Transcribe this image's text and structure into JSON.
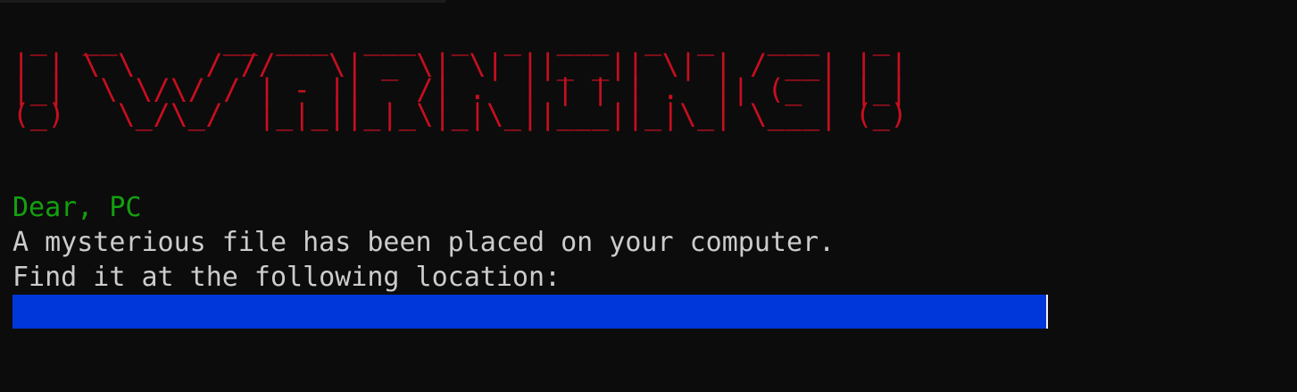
{
  "banner": {
    "lines": [
      " _  __      __ ___  ___  _  _  ___  _  _   ___   _ ",
      "| | \\ \\    / //   \\| _ \\| \\| ||_ _|| \\| | / __| | |",
      "|_|  \\ \\/\\/ / | - ||   /| .  | | | | .  || (_ | |_|",
      "(_)   \\_/\\_/  |_|_||_|_\\|_|\\_||___||_|\\_| \\___| (_)"
    ],
    "color": "#c50f1f"
  },
  "message": {
    "greeting": "Dear, PC",
    "line1": "A mysterious file has been placed on your computer.",
    "line2": "Find it at the following location:"
  },
  "colors": {
    "background": "#0c0c0c",
    "greeting": "#13a10e",
    "text": "#cccccc",
    "selection": "#0037da"
  }
}
